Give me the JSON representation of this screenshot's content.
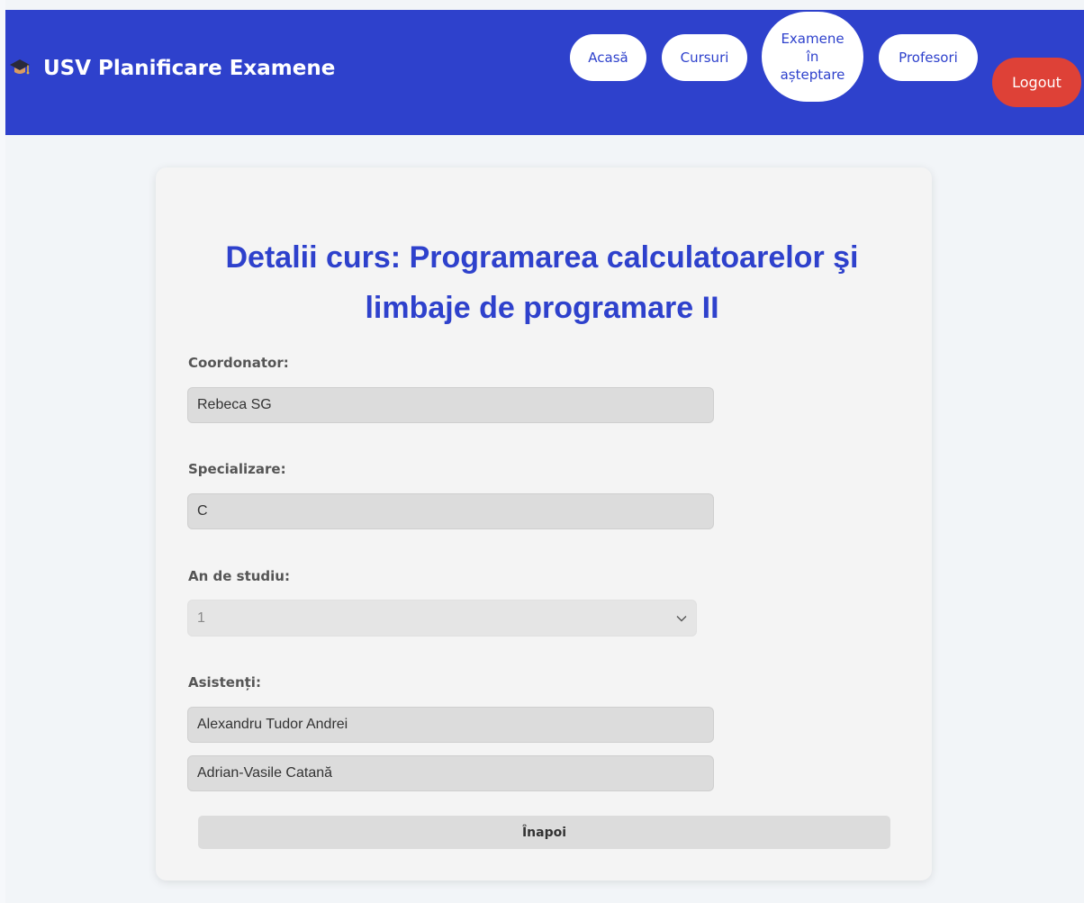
{
  "header": {
    "brand_icon": "graduation-cap-icon",
    "brand_title": "USV Planificare Examene",
    "nav": {
      "home": "Acasă",
      "courses": "Cursuri",
      "pending_exams": "Examene în așteptare",
      "professors": "Profesori"
    },
    "logout": "Logout",
    "colors": {
      "navbar": "#2e41cc",
      "logout": "#de4137",
      "pill": "#ffffff"
    }
  },
  "main": {
    "title": "Detalii curs: Programarea calculatoarelor şi limbaje de programare II",
    "coordinator": {
      "label": "Coordonator:",
      "value": "Rebeca SG"
    },
    "specialization": {
      "label": "Specializare:",
      "value": "C"
    },
    "study_year": {
      "label": "An de studiu:",
      "selected": "1"
    },
    "assistants": {
      "label": "Asistenți:",
      "values": [
        "Alexandru Tudor Andrei",
        "Adrian-Vasile Catană"
      ]
    },
    "back_button": "Înapoi"
  }
}
